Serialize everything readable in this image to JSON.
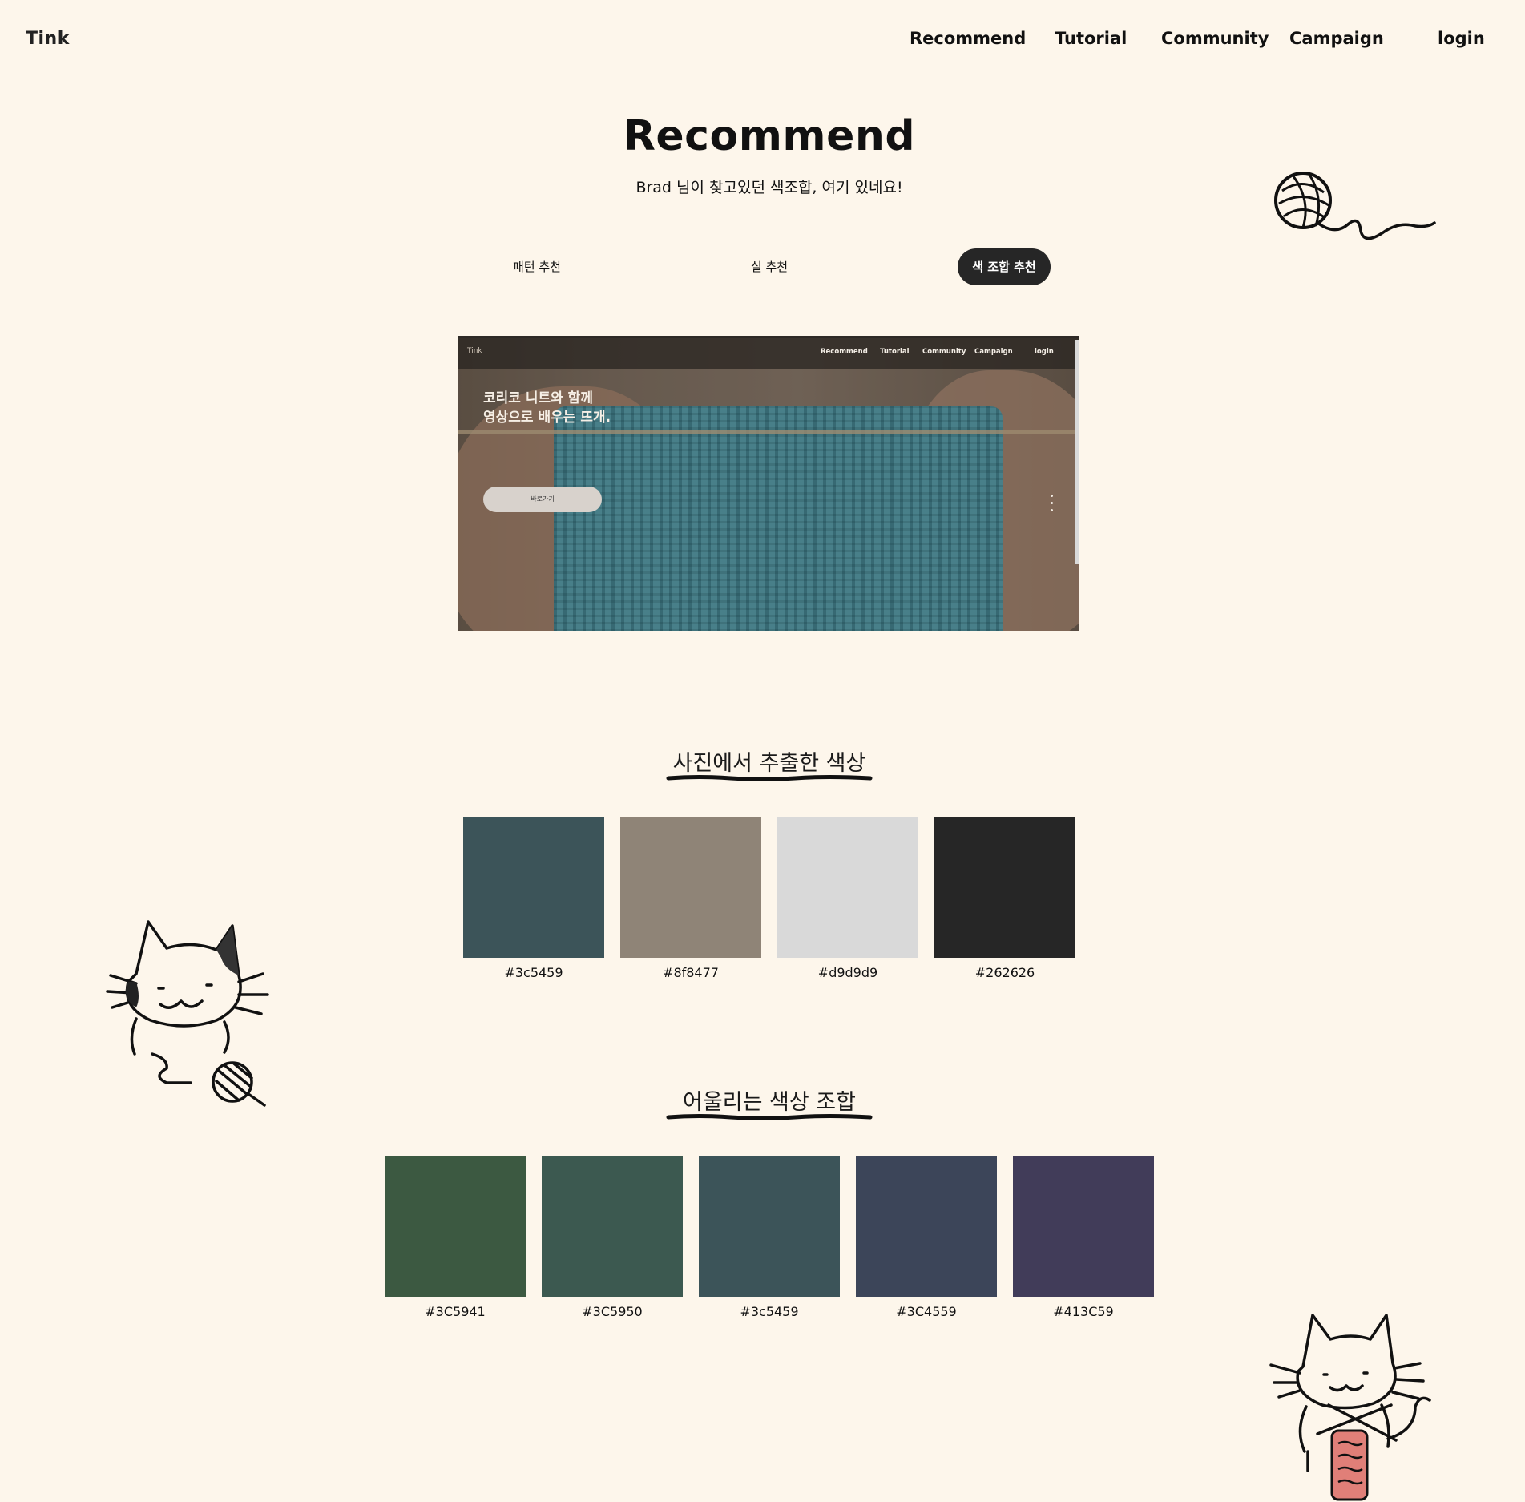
{
  "nav": {
    "logo": "Tink",
    "items": [
      "Recommend",
      "Tutorial",
      "Community",
      "Campaign"
    ],
    "login": "login"
  },
  "hero": {
    "title": "Recommend",
    "subtitle": "Brad 님이 찾고있던 색조합, 여기 있네요!"
  },
  "tabs": [
    {
      "label": "패턴 추천",
      "active": false
    },
    {
      "label": "실 추천",
      "active": false
    },
    {
      "label": "색 조합 추천",
      "active": true
    }
  ],
  "preview": {
    "logo": "Tink",
    "nav": [
      "Recommend",
      "Tutorial",
      "Community",
      "Campaign",
      "login"
    ],
    "headline_line1": "코리코 니트와 함께",
    "headline_line2": "영상으로 배우는 뜨개.",
    "button": "바로가기"
  },
  "extracted": {
    "title": "사진에서 추출한 색상",
    "colors": [
      "#3c5459",
      "#8f8477",
      "#d9d9d9",
      "#262626"
    ]
  },
  "matching": {
    "title": "어울리는 색상 조합",
    "colors": [
      "#3C5941",
      "#3C5950",
      "#3c5459",
      "#3C4559",
      "#413C59"
    ]
  }
}
